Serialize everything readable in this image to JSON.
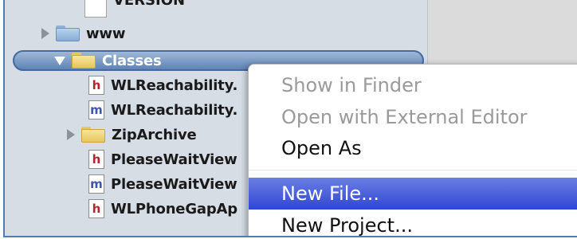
{
  "navigator": {
    "top_item": {
      "label": "VERSION",
      "icon": "file-icon"
    },
    "www_folder": {
      "label": "www",
      "icon": "folder-icon",
      "expanded": false
    },
    "classes_folder": {
      "label": "Classes",
      "icon": "folder-icon",
      "expanded": true,
      "selected": true
    },
    "files": [
      {
        "label": "WLReachability.",
        "type": "h"
      },
      {
        "label": "WLReachability.",
        "type": "m"
      },
      {
        "label": "ZipArchive",
        "type": "folder"
      },
      {
        "label": "PleaseWaitView",
        "type": "h"
      },
      {
        "label": "PleaseWaitView",
        "type": "m"
      },
      {
        "label": "WLPhoneGapAp",
        "type": "h"
      }
    ]
  },
  "context_menu": {
    "items": [
      {
        "label": "Show in Finder",
        "enabled": false
      },
      {
        "label": "Open with External Editor",
        "enabled": false
      },
      {
        "label": "Open As",
        "enabled": true
      },
      {
        "label": "New File...",
        "enabled": true,
        "highlighted": true
      },
      {
        "label": "New Project...",
        "enabled": true
      }
    ]
  },
  "colors": {
    "selection": "#5e83b4",
    "menu_highlight": "#2f46d3",
    "header_letter_h": "#b0272f",
    "implementation_letter_m": "#3e57a8"
  }
}
